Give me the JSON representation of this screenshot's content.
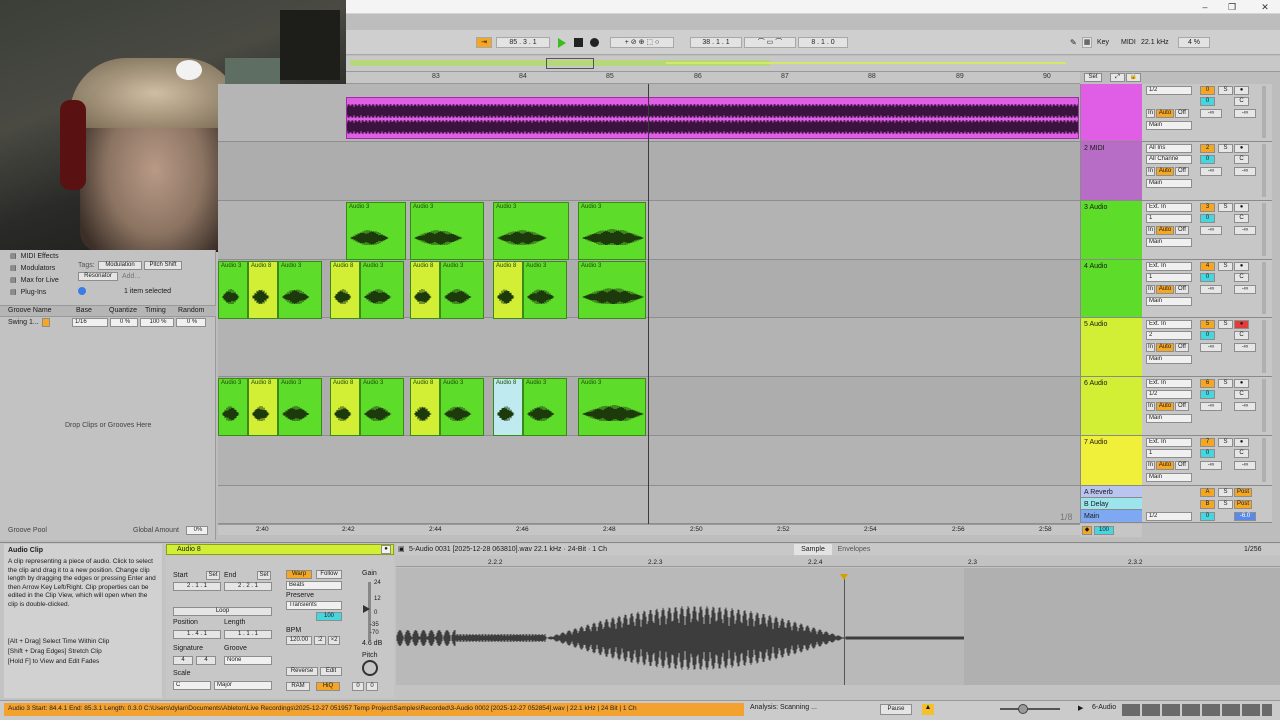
{
  "window_controls": {
    "minimize": "–",
    "restore": "❐",
    "close": "✕"
  },
  "transport": {
    "arrangement_position": "85 . 3 . 1",
    "loop_start": "38 . 1 . 1",
    "loop_length": "8 . 1 . 0",
    "key_label": "Key",
    "midi_label": "MIDI",
    "sample_rate": "22.1 kHz",
    "cpu": "4 %"
  },
  "ruler_bars": [
    "83",
    "84",
    "85",
    "86",
    "87",
    "88",
    "89",
    "90"
  ],
  "time_ruler": [
    "2:40",
    "2:42",
    "2:44",
    "2:46",
    "2:48",
    "2:50",
    "2:52",
    "2:54",
    "2:56",
    "2:58"
  ],
  "zoom_label": "1/8",
  "browser": {
    "categories": [
      "MIDI Effects",
      "Modulators",
      "Max for Live",
      "Plug-Ins"
    ],
    "tags_label": "Tags:",
    "tags": [
      "Modulation",
      "Pitch Shift",
      "Resonator",
      "Add..."
    ],
    "selection_info": "1 item selected",
    "groove_headers": [
      "Groove Name",
      "Base",
      "Quantize",
      "Timing",
      "Random"
    ],
    "groove_row": {
      "name": "Swing 1...",
      "base": "1/16",
      "quantize": "0 %",
      "timing": "100 %",
      "random": "0 %"
    },
    "drop_hint": "Drop Clips or Grooves Here",
    "groove_pool": "Groove Pool",
    "global_amount_label": "Global Amount",
    "global_amount": "0%"
  },
  "tracks": [
    {
      "name": "",
      "input": "1/2",
      "num": "0",
      "color": "#e05ee6",
      "monitor": "In",
      "auto": "Auto",
      "off": "Off",
      "out": "Main",
      "vol": "-∞"
    },
    {
      "name": "2 MIDI",
      "input": "All Ins",
      "input2": "All Channe",
      "num": "2",
      "color": "#b76cc5",
      "monitor": "In",
      "auto": "Auto",
      "off": "Off",
      "out": "Main",
      "vol": "-∞"
    },
    {
      "name": "3 Audio",
      "input": "Ext. In",
      "input2": "1",
      "num": "3",
      "color": "#5ddc2a",
      "monitor": "In",
      "auto": "Auto",
      "off": "Off",
      "out": "Main",
      "vol": "-∞"
    },
    {
      "name": "4 Audio",
      "input": "Ext. In",
      "input2": "1",
      "num": "4",
      "color": "#5ddc2a",
      "monitor": "In",
      "auto": "Auto",
      "off": "Off",
      "out": "Main",
      "vol": "-∞"
    },
    {
      "name": "5 Audio",
      "input": "Ext. In",
      "input2": "2",
      "num": "5",
      "color": "#d2ee35",
      "monitor": "In",
      "auto": "Auto",
      "off": "Off",
      "out": "Main",
      "vol": "-∞"
    },
    {
      "name": "6 Audio",
      "input": "Ext. In",
      "input2": "1/2",
      "num": "6",
      "color": "#d2ee35",
      "monitor": "In",
      "auto": "Auto",
      "off": "Off",
      "out": "Main",
      "vol": "-∞"
    },
    {
      "name": "7 Audio",
      "input": "Ext. In",
      "input2": "1",
      "num": "7",
      "color": "#f0ef3a",
      "monitor": "In",
      "auto": "Auto",
      "off": "Off",
      "out": "Main",
      "vol": "-∞"
    }
  ],
  "returns": [
    {
      "name": "A Reverb",
      "letter": "A",
      "post": "Post"
    },
    {
      "name": "B Delay",
      "letter": "B",
      "post": "Post"
    },
    {
      "name": "Main",
      "input": "1/2",
      "num": "0",
      "vol": "-6.0"
    }
  ],
  "set_label": "Set",
  "clip_labels": {
    "a3": "Audio 3",
    "a8": "Audio 8",
    "a": "A"
  },
  "clip_view": {
    "info_title": "Audio Clip",
    "info_text": "A clip representing a piece of audio. Click to select the clip and drag it to a new position. Change clip length by dragging the edges or pressing Enter and then Arrow Key Left/Right. Clip properties can be edited in the Clip View, which will open when the clip is double-clicked.",
    "info_shortcuts": [
      "[Alt + Drag] Select Time Within Clip",
      "[Shift + Drag Edges] Stretch Clip",
      "[Hold F] to View and Edit Fades"
    ],
    "clip_name": "Audio 8",
    "start_label": "Start",
    "end_label": "End",
    "set_btn": "Set",
    "start_val": "2 . 1 . 1",
    "end_val": "2 . 2 . 1",
    "loop_label": "Loop",
    "position_label": "Position",
    "length_label": "Length",
    "position_val": "1 . 4 . 1",
    "length_val": "1 . 1 . 1",
    "signature_label": "Signature",
    "groove_label": "Groove",
    "sig_num": "4",
    "sig_den": "4",
    "groove_val": "None",
    "scale_label": "Scale",
    "scale_root": "C",
    "scale_mode": "Major",
    "warp": "Warp",
    "follow": "Follow",
    "beats": "Beats",
    "preserve_label": "Preserve",
    "preserve_val": "Transients",
    "bpm_label": "BPM",
    "bpm_val": "120.00",
    "half": ":2",
    "double": "×2",
    "seg_val": "100",
    "reverse": "Reverse",
    "edit": "Edit",
    "ram": "RAM",
    "hiq": "HiQ",
    "gain_label": "Gain",
    "gain_val": "4.6 dB",
    "pitch_label": "Pitch",
    "pitch_semis": "0",
    "pitch_cents": "0",
    "gain_scale": [
      "24",
      "12",
      "0",
      "-35",
      "-70"
    ],
    "file_info": "5-Audio 0031 [2025-12-28 063810].wav  22.1 kHz · 24-Bit · 1 Ch",
    "tab_sample": "Sample",
    "tab_envelopes": "Envelopes",
    "zoom": "1/256",
    "ruler": [
      "2.2.2",
      "2.2.3",
      "2.2.4",
      "2.3",
      "2.3.2"
    ]
  },
  "status": {
    "message": "Audio 3  Start: 84.4.1  End: 85.3.1  Length: 0.3.0  C:\\Users\\dylan\\Documents\\Ableton\\Live Recordings\\2025-12-27 051957 Temp Project\\Samples\\Recorded\\3-Audio 0002 [2025-12-27 052854].wav | 22.1 kHz | 24 Bit | 1 Ch",
    "analysis": "Analysis: Scanning ...",
    "pause": "Pause",
    "track_name": "6-Audio"
  }
}
